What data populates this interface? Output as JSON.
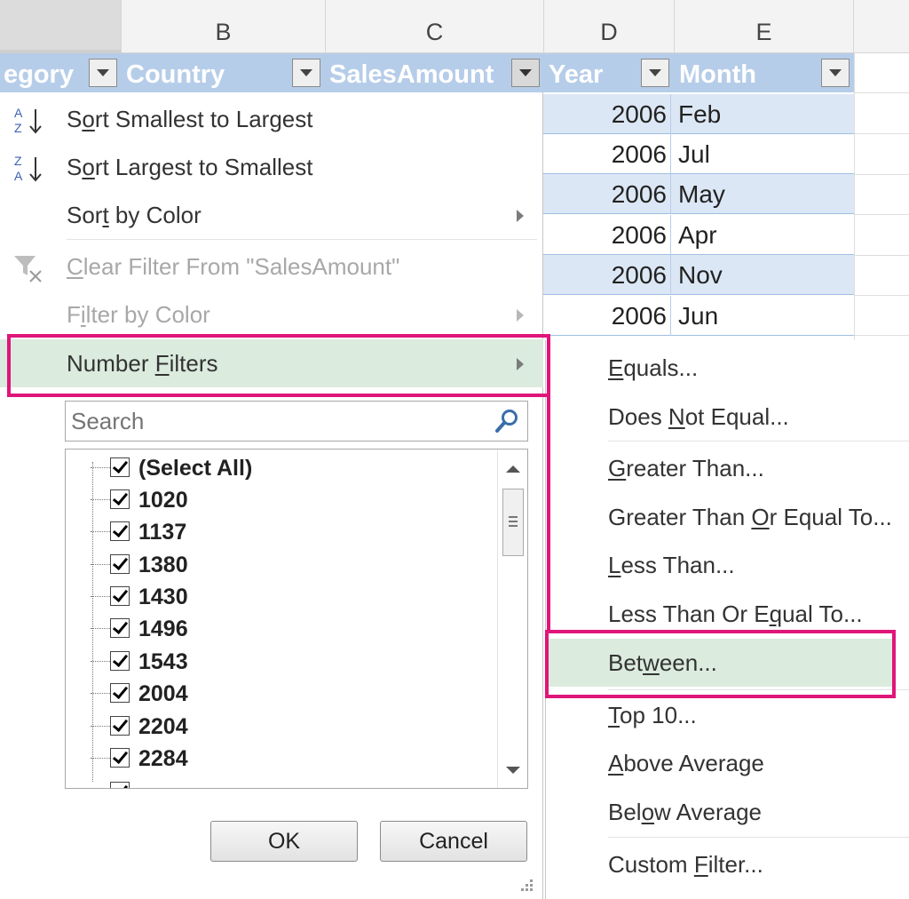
{
  "columns": {
    "letters": [
      "",
      "B",
      "C",
      "D",
      "E"
    ]
  },
  "table_headers": [
    {
      "label": "egory"
    },
    {
      "label": "Country"
    },
    {
      "label": "SalesAmount"
    },
    {
      "label": "Year"
    },
    {
      "label": "Month"
    }
  ],
  "rows": [
    {
      "year": "2006",
      "month": "Feb"
    },
    {
      "year": "2006",
      "month": "Jul"
    },
    {
      "year": "2006",
      "month": "May"
    },
    {
      "year": "2006",
      "month": "Apr"
    },
    {
      "year": "2006",
      "month": "Nov"
    },
    {
      "year": "2006",
      "month": "Jun"
    }
  ],
  "menu": {
    "sort_asc": {
      "pre": "S",
      "u": "o",
      "post": "rt Smallest to Largest"
    },
    "sort_desc": {
      "pre": "S",
      "u": "o",
      "post": "rt Largest to Smallest"
    },
    "sort_color": {
      "pre": "Sor",
      "u": "t",
      "post": " by Color"
    },
    "clear_filter": {
      "pre": "",
      "u": "C",
      "post": "lear Filter From \"SalesAmount\""
    },
    "filter_color": {
      "pre": "F",
      "u": "i",
      "post": "lter by Color"
    },
    "number_filters": {
      "pre": "Number ",
      "u": "F",
      "post": "ilters"
    }
  },
  "search": {
    "placeholder": "Search"
  },
  "list_items": [
    "(Select All)",
    "1020",
    "1137",
    "1380",
    "1430",
    "1496",
    "1543",
    "2004",
    "2204",
    "2284"
  ],
  "buttons": {
    "ok": "OK",
    "cancel": "Cancel"
  },
  "submenu": {
    "equals": {
      "pre": "",
      "u": "E",
      "post": "quals..."
    },
    "not_equal": {
      "pre": "Does ",
      "u": "N",
      "post": "ot Equal..."
    },
    "greater": {
      "pre": "",
      "u": "G",
      "post": "reater Than..."
    },
    "greater_eq": {
      "pre": "Greater Than ",
      "u": "O",
      "post": "r Equal To..."
    },
    "less": {
      "pre": "",
      "u": "L",
      "post": "ess Than..."
    },
    "less_eq": {
      "pre": "Less Than Or E",
      "u": "q",
      "post": "ual To..."
    },
    "between": {
      "pre": "Bet",
      "u": "w",
      "post": "een..."
    },
    "top10": {
      "pre": "",
      "u": "T",
      "post": "op 10..."
    },
    "above_avg": {
      "pre": "",
      "u": "A",
      "post": "bove Average"
    },
    "below_avg": {
      "pre": "Bel",
      "u": "o",
      "post": "w Average"
    },
    "custom": {
      "pre": "Custom ",
      "u": "F",
      "post": "ilter..."
    }
  },
  "colors": {
    "highlight_box": "#e0157a",
    "header_fill": "#b6cde9",
    "band_fill": "#dce7f5",
    "hover_fill": "#dbebde"
  }
}
